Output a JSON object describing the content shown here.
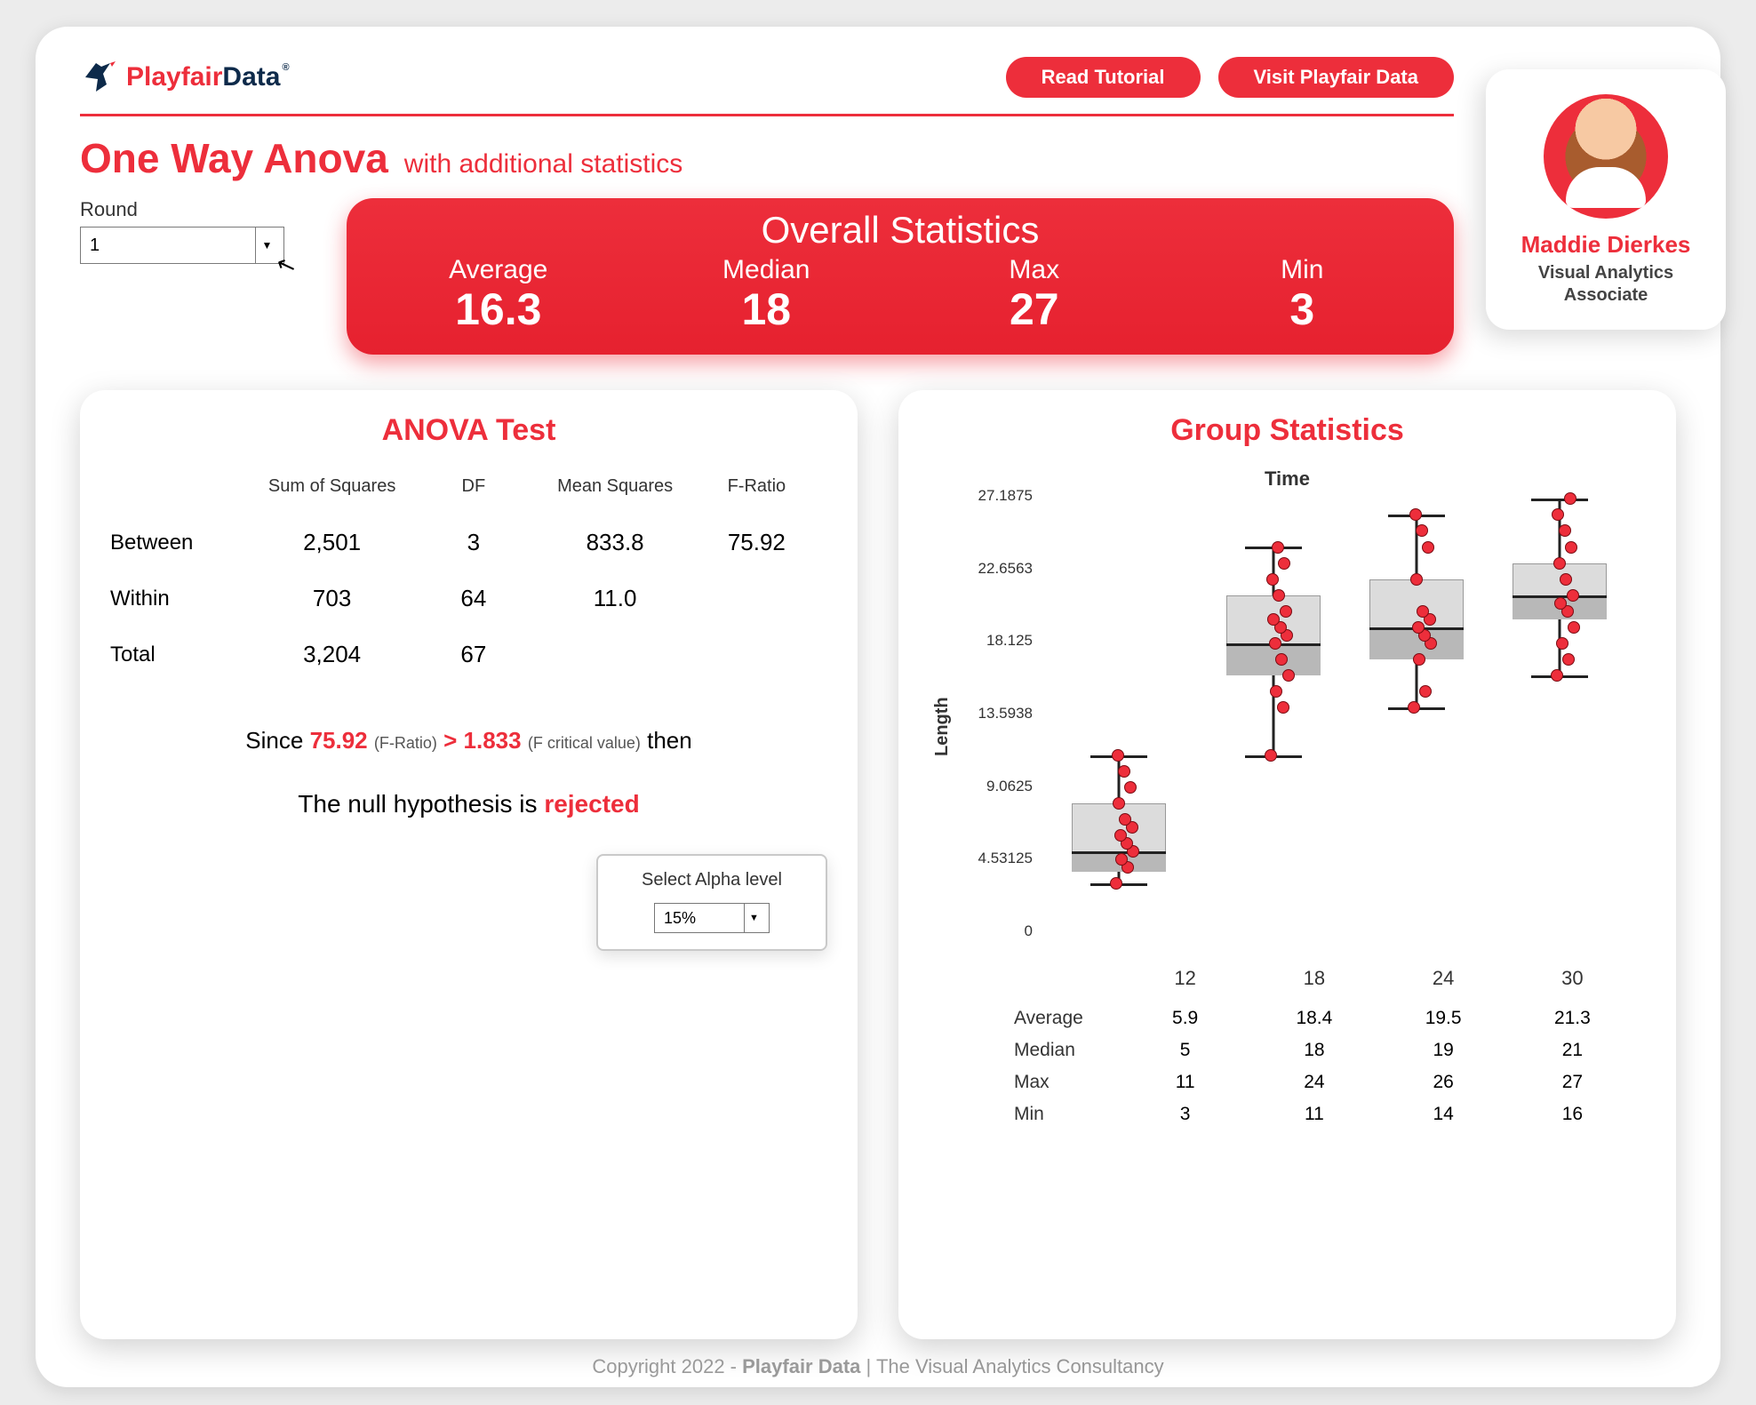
{
  "header": {
    "logo_playfair": "Playfair",
    "logo_data": "Data",
    "logo_reg": "®",
    "read_tutorial": "Read Tutorial",
    "visit_playfair": "Visit Playfair Data"
  },
  "profile": {
    "name": "Maddie Dierkes",
    "role_line1": "Visual Analytics",
    "role_line2": "Associate"
  },
  "title": {
    "main": "One Way Anova",
    "sub": "with additional statistics"
  },
  "round": {
    "label": "Round",
    "value": "1"
  },
  "overall": {
    "title": "Overall Statistics",
    "labels": {
      "avg": "Average",
      "med": "Median",
      "max": "Max",
      "min": "Min"
    },
    "values": {
      "avg": "16.3",
      "med": "18",
      "max": "27",
      "min": "3"
    }
  },
  "anova": {
    "title": "ANOVA Test",
    "headers": {
      "ss": "Sum of Squares",
      "df": "DF",
      "ms": "Mean Squares",
      "f": "F-Ratio"
    },
    "rows": {
      "between": {
        "label": "Between",
        "ss": "2,501",
        "df": "3",
        "ms": "833.8",
        "f": "75.92"
      },
      "within": {
        "label": "Within",
        "ss": "703",
        "df": "64",
        "ms": "11.0",
        "f": ""
      },
      "total": {
        "label": "Total",
        "ss": "3,204",
        "df": "67",
        "ms": "",
        "f": ""
      }
    },
    "conclusion": {
      "since": "Since",
      "fval": "75.92",
      "f_lab": "(F-Ratio)",
      "gt": ">",
      "fcrit": "1.833",
      "fcrit_lab": "(F critical value)",
      "then": "then",
      "line2_a": "The null hypothesis is ",
      "line2_b": "rejected"
    },
    "alpha": {
      "label": "Select Alpha level",
      "value": "15%"
    }
  },
  "group": {
    "title": "Group Statistics",
    "chart_title": "Time",
    "ylabel": "Length",
    "categories": [
      "12",
      "18",
      "24",
      "30"
    ],
    "summary": {
      "labels": {
        "avg": "Average",
        "med": "Median",
        "max": "Max",
        "min": "Min"
      },
      "avg": [
        "5.9",
        "18.4",
        "19.5",
        "21.3"
      ],
      "med": [
        "5",
        "18",
        "19",
        "21"
      ],
      "max": [
        "11",
        "24",
        "26",
        "27"
      ],
      "min": [
        "3",
        "11",
        "14",
        "16"
      ]
    }
  },
  "chart_data": {
    "type": "boxplot",
    "title": "Time",
    "xlabel": "",
    "ylabel": "Length",
    "ylim": [
      0,
      27.19
    ],
    "yticks": [
      0,
      4.53125,
      9.0625,
      13.5938,
      18.125,
      22.6563,
      27.1875
    ],
    "categories": [
      "12",
      "18",
      "24",
      "30"
    ],
    "series": [
      {
        "name": "12",
        "min": 3,
        "q1": 3.7,
        "median": 5,
        "q3": 8,
        "max": 11,
        "mean": 5.9,
        "points": [
          3,
          4,
          4.5,
          5,
          5.5,
          6,
          6.5,
          7,
          8,
          9,
          10,
          11
        ]
      },
      {
        "name": "18",
        "min": 11,
        "q1": 16,
        "median": 18,
        "q3": 21,
        "max": 24,
        "mean": 18.4,
        "points": [
          11,
          14,
          15,
          16,
          17,
          18,
          18.5,
          19,
          19.5,
          20,
          21,
          22,
          23,
          24
        ]
      },
      {
        "name": "24",
        "min": 14,
        "q1": 17,
        "median": 19,
        "q3": 22,
        "max": 26,
        "mean": 19.5,
        "points": [
          14,
          15,
          17,
          18,
          18.5,
          19,
          19.5,
          20,
          22,
          24,
          25,
          26
        ]
      },
      {
        "name": "30",
        "min": 16,
        "q1": 19.5,
        "median": 21,
        "q3": 23,
        "max": 27,
        "mean": 21.3,
        "points": [
          16,
          17,
          18,
          19,
          20,
          20.5,
          21,
          22,
          23,
          24,
          25,
          26,
          27
        ]
      }
    ]
  },
  "yticks_display": [
    "27.1875",
    "22.6563",
    "18.125",
    "13.5938",
    "9.0625",
    "4.53125",
    "0"
  ],
  "footer": {
    "prefix": "Copyright 2022 - ",
    "bold": "Playfair Data",
    "suffix": " | The Visual Analytics Consultancy"
  }
}
